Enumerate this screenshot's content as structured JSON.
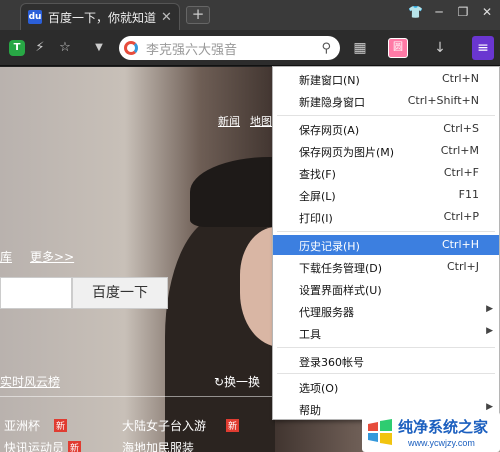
{
  "tab": {
    "title": "百度一下，你就知道",
    "close": "✕",
    "favicon": "du"
  },
  "newtab": "+",
  "window_buttons": [
    "👕",
    "─",
    "❐",
    "✕"
  ],
  "toolbar": {
    "shield": "T",
    "bolt": "⚡",
    "star": "☆",
    "dropdown": "▼",
    "search_text": "李克强六大强音",
    "search_icon": "⚲",
    "apps_icon": "▦",
    "wf_icon": "圆",
    "download_icon": "↓",
    "menu_icon": "≡"
  },
  "page": {
    "topnav": [
      "新闻",
      "地图"
    ],
    "links": [
      "库",
      "更多>>"
    ],
    "search_button": "百度一下",
    "hot_title": "实时风云榜",
    "refresh": "↻换一换",
    "news": [
      {
        "left": "亚洲杯",
        "mid": "大陆女子台入游"
      },
      {
        "left": "快讯运动员",
        "mid": "海地加民服装"
      }
    ],
    "badge": "新"
  },
  "menu": {
    "items": [
      {
        "label": "新建窗口(N)",
        "shortcut": "Ctrl+N"
      },
      {
        "label": "新建隐身窗口",
        "shortcut": "Ctrl+Shift+N"
      },
      {
        "label": "保存网页(A)",
        "shortcut": "Ctrl+S"
      },
      {
        "label": "保存网页为图片(M)",
        "shortcut": "Ctrl+M"
      },
      {
        "label": "查找(F)",
        "shortcut": "Ctrl+F"
      },
      {
        "label": "全屏(L)",
        "shortcut": "F11"
      },
      {
        "label": "打印(I)",
        "shortcut": "Ctrl+P"
      },
      {
        "label": "历史记录(H)",
        "shortcut": "Ctrl+H"
      },
      {
        "label": "下载任务管理(D)",
        "shortcut": "Ctrl+J"
      },
      {
        "label": "设置界面样式(U)",
        "shortcut": ""
      },
      {
        "label": "代理服务器",
        "shortcut": ""
      },
      {
        "label": "工具",
        "shortcut": ""
      },
      {
        "label": "登录360帐号",
        "shortcut": ""
      },
      {
        "label": "选项(O)",
        "shortcut": ""
      },
      {
        "label": "帮助",
        "shortcut": ""
      }
    ],
    "highlighted_index": 7,
    "submenu_arrow": "▶"
  },
  "watermark": {
    "title": "纯净系统之家",
    "url": "www.ycwjzy.com"
  },
  "colors": {
    "menu_highlight": "#3c7fe0",
    "menu_button": "#6a36d1",
    "shield": "#28a745"
  }
}
